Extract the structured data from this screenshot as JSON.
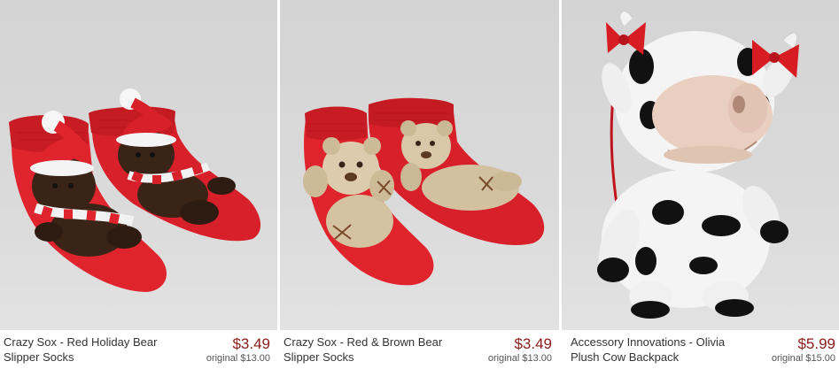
{
  "products": [
    {
      "title_line1": "Crazy Sox - Red Holiday Bear",
      "title_line2": "Slipper Socks",
      "price": "$3.49",
      "original_price": "original $13.00",
      "image_icon": "red-holiday-bear-slipper-socks-photo"
    },
    {
      "title_line1": "Crazy Sox - Red & Brown Bear",
      "title_line2": "Slipper Socks",
      "price": "$3.49",
      "original_price": "original $13.00",
      "image_icon": "red-brown-bear-slipper-socks-photo"
    },
    {
      "title_line1": "Accessory Innovations - Olivia",
      "title_line2": "Plush Cow Backpack",
      "price": "$5.99",
      "original_price": "original $15.00",
      "image_icon": "plush-cow-backpack-photo"
    }
  ],
  "colors": {
    "price": "#8b1a1a",
    "title": "#333333",
    "photo_background": "#d8d8d8"
  }
}
